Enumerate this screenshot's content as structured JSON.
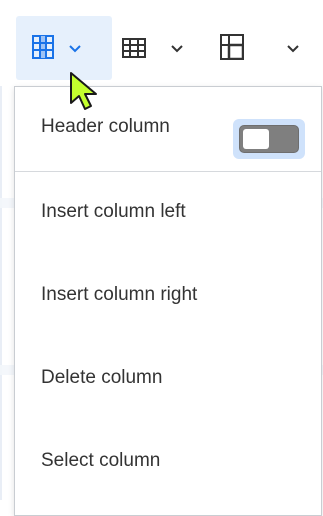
{
  "toolbar": {
    "buttons": [
      {
        "icon": "table-column-icon",
        "active": true
      },
      {
        "icon": "table-row-icon",
        "active": false
      },
      {
        "icon": "merge-cells-icon",
        "active": false
      }
    ]
  },
  "menu": {
    "header_column": {
      "label": "Header column",
      "toggle_on": false
    },
    "items": [
      {
        "label": "Insert column left"
      },
      {
        "label": "Insert column right"
      },
      {
        "label": "Delete column"
      },
      {
        "label": "Select column"
      }
    ]
  },
  "colors": {
    "accent": "#1a73e8",
    "active_bg": "#e6f0fc",
    "icon": "#333333",
    "cursor": "#c4ff2e"
  }
}
